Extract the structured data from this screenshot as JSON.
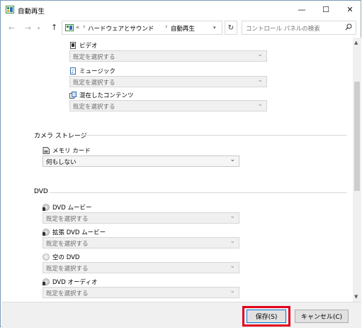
{
  "window": {
    "title": "自動再生",
    "minimize": "—",
    "maximize": "☐",
    "close": "✕"
  },
  "navbar": {
    "back": "←",
    "forward": "→",
    "up": "↑",
    "breadcrumb_overflow": "«",
    "breadcrumb": [
      "ハードウェアとサウンド",
      "自動再生"
    ],
    "refresh": "↻",
    "search_placeholder": "コントロール パネルの検索"
  },
  "media_group": [
    {
      "label": "ビデオ",
      "icon": "video-file-icon",
      "value": "既定を選択する"
    },
    {
      "label": "ミュージック",
      "icon": "music-file-icon",
      "value": "既定を選択する"
    },
    {
      "label": "混在したコンテンツ",
      "icon": "mixed-content-icon",
      "value": "既定を選択する"
    }
  ],
  "camera_storage": {
    "title": "カメラ ストレージ",
    "items": [
      {
        "label": "メモリ カード",
        "icon": "memory-card-icon",
        "value": "何もしない"
      }
    ]
  },
  "dvd": {
    "title": "DVD",
    "items": [
      {
        "label": "DVD ムービー",
        "icon": "dvd-disc-icon",
        "value": "既定を選択する"
      },
      {
        "label": "拡張 DVD ムービー",
        "icon": "dvd-disc-icon",
        "value": "既定を選択する"
      },
      {
        "label": "空の DVD",
        "icon": "blank-disc-icon",
        "value": "既定を選択する"
      },
      {
        "label": "DVD オーディオ",
        "icon": "dvd-disc-icon",
        "value": "既定を選択する"
      }
    ]
  },
  "footer": {
    "save": "保存(S)",
    "cancel": "キャンセル(C)"
  },
  "colors": {
    "highlight": "#e2001a",
    "primary_border": "#0078d7"
  }
}
